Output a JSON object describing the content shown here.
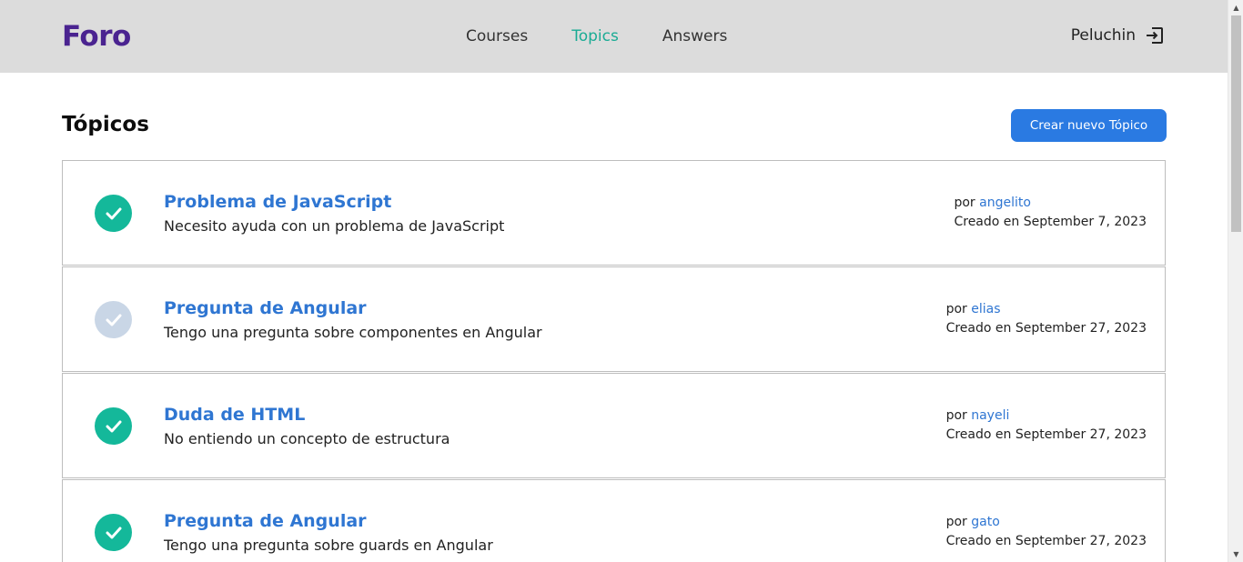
{
  "header": {
    "logo": "Foro",
    "nav": [
      {
        "label": "Courses",
        "active": false
      },
      {
        "label": "Topics",
        "active": true
      },
      {
        "label": "Answers",
        "active": false
      }
    ],
    "user_name": "Peluchin",
    "logout_icon": "logout-icon"
  },
  "main": {
    "title": "Tópicos",
    "new_topic_button": "Crear nuevo Tópico"
  },
  "topics": [
    {
      "title": "Problema de JavaScript",
      "description": "Necesito ayuda con un problema de JavaScript",
      "by_prefix": "por",
      "author": "angelito",
      "created": "Creado en September 7, 2023",
      "status": "solved"
    },
    {
      "title": "Pregunta de Angular",
      "description": "Tengo una pregunta sobre componentes en Angular",
      "by_prefix": "por",
      "author": "elias",
      "created": "Creado en September 27, 2023",
      "status": "pending"
    },
    {
      "title": "Duda de HTML",
      "description": "No entiendo un concepto de estructura",
      "by_prefix": "por",
      "author": "nayeli",
      "created": "Creado en September 27, 2023",
      "status": "solved"
    },
    {
      "title": "Pregunta de Angular",
      "description": "Tengo una pregunta sobre guards en Angular",
      "by_prefix": "por",
      "author": "gato",
      "created": "Creado en September 27, 2023",
      "status": "solved"
    }
  ],
  "colors": {
    "logo": "#4a2390",
    "active_nav": "#1aab94",
    "primary": "#2a7ae2",
    "link": "#2f76d2",
    "solved": "#14b89a",
    "pending": "#c9d6e6",
    "header_bg": "#dcdcdc"
  }
}
